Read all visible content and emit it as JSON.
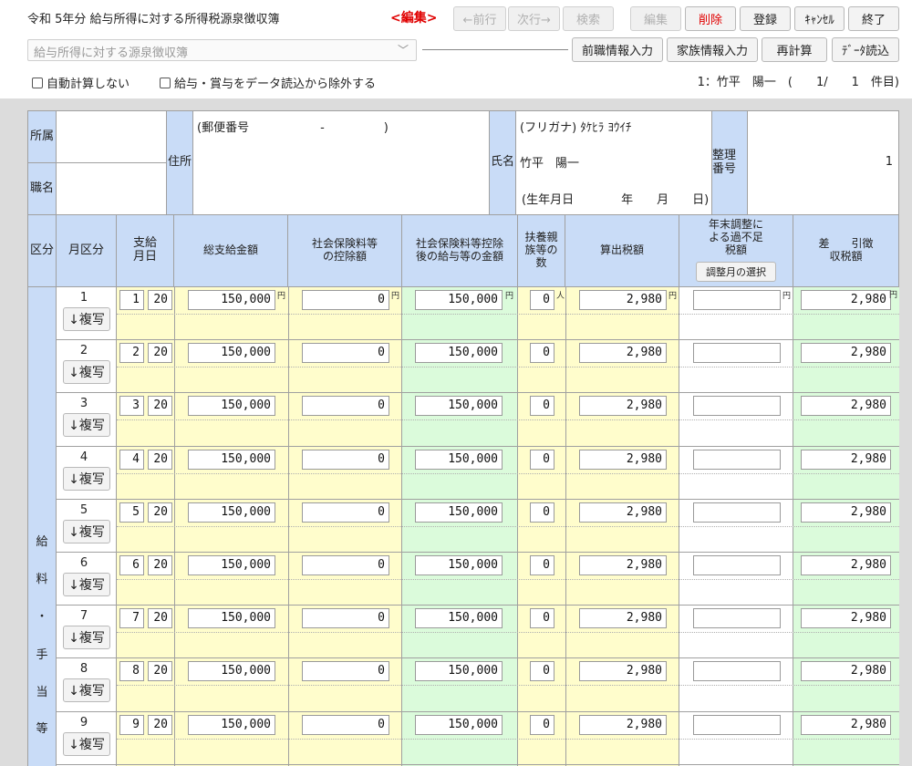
{
  "header": {
    "title": "令和 5年分 給与所得に対する所得税源泉徴収簿",
    "mode": "<編集>"
  },
  "toolbar": {
    "prev": "←前行",
    "next": "次行→",
    "search": "検索",
    "edit": "編集",
    "delete": "削除",
    "register": "登録",
    "cancel": "ｷｬﾝｾﾙ",
    "close": "終了",
    "prev_job": "前職情報入力",
    "family": "家族情報入力",
    "recalc": "再計算",
    "data_load": "ﾃﾞｰﾀ読込"
  },
  "select": {
    "value": "給与所得に対する源泉徴収簿"
  },
  "options": {
    "no_auto_calc": "自動計算しない",
    "exclude_salary": "給与・賞与をデータ読込から除外する"
  },
  "record_info": "1：竹平　陽一　(　　1/　　1　件目)",
  "person": {
    "affiliation_label": "所属",
    "job_label": "職名",
    "address_label": "住所",
    "postal": "(郵便番号　　　　　　-　　　　　)",
    "name_label": "氏名",
    "kana": "(フリガナ) ﾀｹﾋﾗ ﾖｳｲﾁ",
    "name": "竹平　陽一",
    "birth": "(生年月日　　　　年　　月　　日)",
    "ref_label": "整理番号",
    "ref_no": "1"
  },
  "table_headers": {
    "kubun": "区分",
    "month_kubun": "月区分",
    "pay_date": "支給月日",
    "gross": "総支給金額",
    "social": "社会保険料等の控除額",
    "after_social": "社会保険料等控除後の給与等の金額",
    "dependents": "扶養親族等の数",
    "tax": "算出税額",
    "year_end": "年末調整による過不足税額",
    "adj_month_btn": "調整月の選択",
    "withheld": "差　　引徴収税額"
  },
  "units": {
    "yen": "円",
    "person": "人"
  },
  "side_label": [
    "給",
    "料",
    "・",
    "手",
    "当",
    "等"
  ],
  "copy_label": "↓複写",
  "rows": [
    {
      "month": "1",
      "pay_month": "1",
      "pay_day": "20",
      "gross": "150,000",
      "social": "0",
      "after": "150,000",
      "deps": "0",
      "tax": "2,980",
      "adj": "",
      "withheld": "2,980"
    },
    {
      "month": "2",
      "pay_month": "2",
      "pay_day": "20",
      "gross": "150,000",
      "social": "0",
      "after": "150,000",
      "deps": "0",
      "tax": "2,980",
      "adj": "",
      "withheld": "2,980"
    },
    {
      "month": "3",
      "pay_month": "3",
      "pay_day": "20",
      "gross": "150,000",
      "social": "0",
      "after": "150,000",
      "deps": "0",
      "tax": "2,980",
      "adj": "",
      "withheld": "2,980"
    },
    {
      "month": "4",
      "pay_month": "4",
      "pay_day": "20",
      "gross": "150,000",
      "social": "0",
      "after": "150,000",
      "deps": "0",
      "tax": "2,980",
      "adj": "",
      "withheld": "2,980"
    },
    {
      "month": "5",
      "pay_month": "5",
      "pay_day": "20",
      "gross": "150,000",
      "social": "0",
      "after": "150,000",
      "deps": "0",
      "tax": "2,980",
      "adj": "",
      "withheld": "2,980"
    },
    {
      "month": "6",
      "pay_month": "6",
      "pay_day": "20",
      "gross": "150,000",
      "social": "0",
      "after": "150,000",
      "deps": "0",
      "tax": "2,980",
      "adj": "",
      "withheld": "2,980"
    },
    {
      "month": "7",
      "pay_month": "7",
      "pay_day": "20",
      "gross": "150,000",
      "social": "0",
      "after": "150,000",
      "deps": "0",
      "tax": "2,980",
      "adj": "",
      "withheld": "2,980"
    },
    {
      "month": "8",
      "pay_month": "8",
      "pay_day": "20",
      "gross": "150,000",
      "social": "0",
      "after": "150,000",
      "deps": "0",
      "tax": "2,980",
      "adj": "",
      "withheld": "2,980"
    },
    {
      "month": "9",
      "pay_month": "9",
      "pay_day": "20",
      "gross": "150,000",
      "social": "0",
      "after": "150,000",
      "deps": "0",
      "tax": "2,980",
      "adj": "",
      "withheld": "2,980"
    }
  ]
}
